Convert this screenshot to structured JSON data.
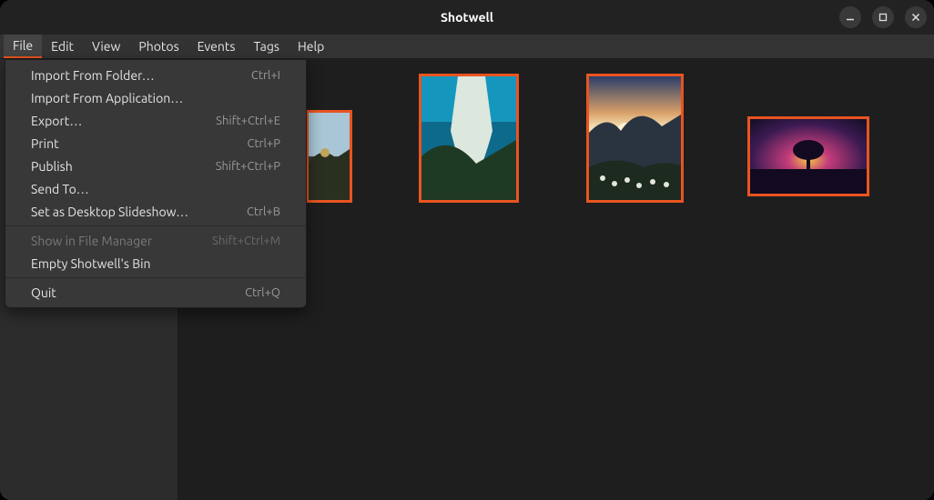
{
  "window": {
    "title": "Shotwell"
  },
  "menubar": [
    "File",
    "Edit",
    "View",
    "Photos",
    "Events",
    "Tags",
    "Help"
  ],
  "file_menu": {
    "items": [
      {
        "label": "Import From Folder…",
        "shortcut": "Ctrl+I",
        "enabled": true
      },
      {
        "label": "Import From Application…",
        "shortcut": "",
        "enabled": true
      },
      {
        "label": "Export…",
        "shortcut": "Shift+Ctrl+E",
        "enabled": true
      },
      {
        "label": "Print",
        "shortcut": "Ctrl+P",
        "enabled": true
      },
      {
        "label": "Publish",
        "shortcut": "Shift+Ctrl+P",
        "enabled": true
      },
      {
        "label": "Send To…",
        "shortcut": "",
        "enabled": true
      },
      {
        "label": "Set as Desktop Slideshow…",
        "shortcut": "Ctrl+B",
        "enabled": true
      }
    ],
    "items2": [
      {
        "label": "Show in File Manager",
        "shortcut": "Shift+Ctrl+M",
        "enabled": false
      },
      {
        "label": "Empty Shotwell's Bin",
        "shortcut": "",
        "enabled": true
      }
    ],
    "items3": [
      {
        "label": "Quit",
        "shortcut": "Ctrl+Q",
        "enabled": true
      }
    ]
  },
  "colors": {
    "accent": "#e95420"
  }
}
